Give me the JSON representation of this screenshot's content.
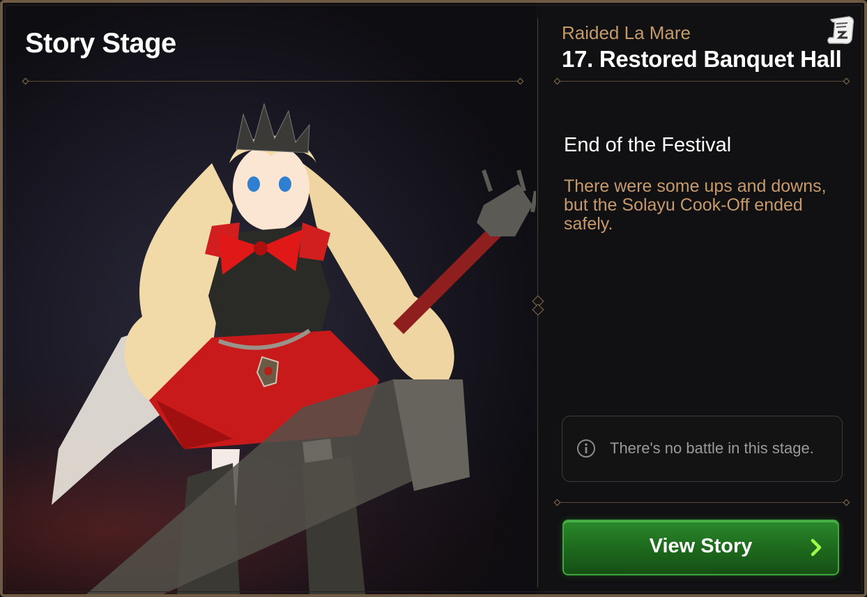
{
  "header": {
    "title": "Story Stage"
  },
  "stage": {
    "chapter": "Raided La Mare",
    "name": "17. Restored Banquet Hall",
    "subtitle": "End of the Festival",
    "description": "There were some ups and downs, but the Solayu Cook-Off ended safely."
  },
  "notice": {
    "text": "There's no battle in this stage.",
    "icon": "info-icon"
  },
  "actions": {
    "view_story_label": "View Story",
    "arrow_icon": "chevron-right-icon",
    "story_log_icon": "scroll-icon"
  },
  "colors": {
    "accent_gold": "#c49a68",
    "button_green": "#1f6d1f",
    "frame": "#6e5a45"
  }
}
